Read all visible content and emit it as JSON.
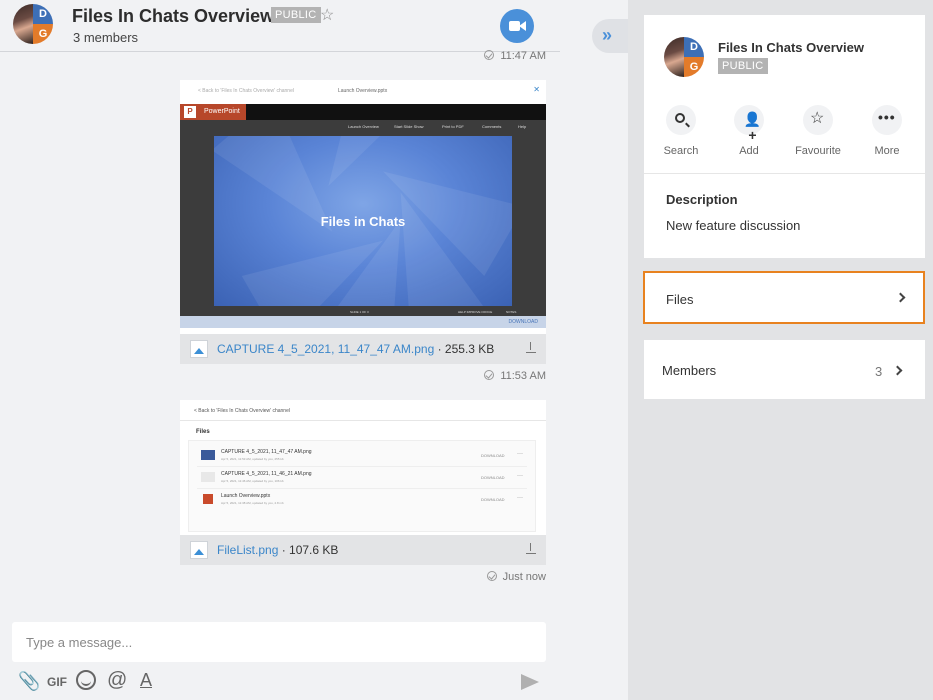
{
  "channel": {
    "title": "Files In Chats Overview",
    "badge": "PUBLIC",
    "members_text": "3 members",
    "avatar_letters": [
      "D",
      "G"
    ]
  },
  "messages": [
    {
      "timestamp": "11:47 AM",
      "attachment": {
        "kind": "ppt-capture",
        "preview": {
          "back_link": "< Back to 'Files In Chats Overview' channel",
          "doc_title": "Launch Overview.pptx",
          "app_name": "PowerPoint",
          "toolbar_items": [
            "Launch Overview",
            "Start Slide Show",
            "Print to PDF",
            "Comments",
            "Help"
          ],
          "slide_title": "Files in Chats",
          "slide_counter": "SLIDE 1 OF 3",
          "nav_right": "HELP IMPROVE OFFICE",
          "notes_label": "NOTES",
          "download_label": "DOWNLOAD"
        },
        "file_name": "CAPTURE 4_5_2021, 11_47_47 AM.png",
        "file_size": " · 255.3 KB"
      }
    },
    {
      "timestamp": "11:53 AM",
      "attachment": {
        "kind": "filelist-capture",
        "preview": {
          "back_link": "< Back to 'Files In Chats Overview' channel",
          "heading": "Files",
          "rows": [
            {
              "name": "CAPTURE 4_5_2021, 11_47_47 AM.png",
              "sub": "Apr 5, 2021, 11:53 AM, updated by you, 255 kb",
              "action": "DOWNLOAD"
            },
            {
              "name": "CAPTURE 4_5_2021, 11_46_21 AM.png",
              "sub": "Apr 5, 2021, 11:46 AM, updated by you, 106 kb",
              "action": "DOWNLOAD"
            },
            {
              "name": "Launch Overview.pptx",
              "sub": "Apr 5, 2021, 11:38 AM, updated by you, 2.8 mb",
              "action": "DOWNLOAD"
            }
          ]
        },
        "file_name": "FileList.png",
        "file_size": " · 107.6 KB"
      }
    }
  ],
  "last_timestamp": "Just now",
  "composer": {
    "placeholder": "Type a message...",
    "tools": {
      "gif": "GIF",
      "mention": "@",
      "format": "A"
    }
  },
  "panel": {
    "title": "Files In Chats Overview",
    "badge": "PUBLIC",
    "actions": [
      {
        "label": "Search",
        "icon": "search-icon"
      },
      {
        "label": "Add",
        "icon": "add-person-icon"
      },
      {
        "label": "Favourite",
        "icon": "star-icon"
      },
      {
        "label": "More",
        "icon": "more-dots-icon"
      }
    ],
    "description_heading": "Description",
    "description_text": "New feature discussion",
    "files_label": "Files",
    "members_label": "Members",
    "members_count": "3"
  },
  "colors": {
    "accent": "#4a90d9",
    "highlight_border": "#e8821f",
    "link": "#3b86c9",
    "ppt_red": "#b7472a"
  }
}
